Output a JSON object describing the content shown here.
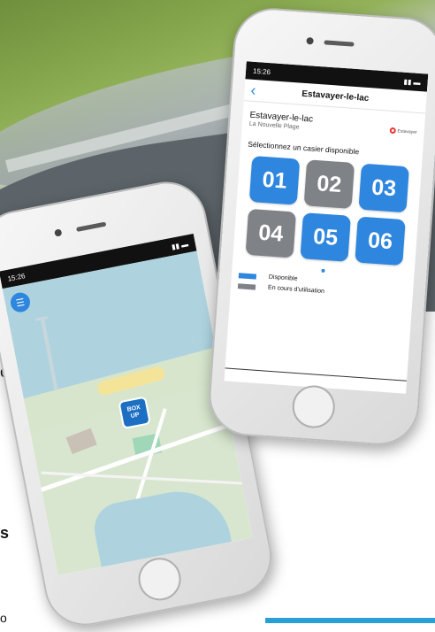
{
  "colors": {
    "available": "#2e86de",
    "in_use": "#7f8286",
    "pin": "#1d6fc4",
    "bluebar": "#2a9fd6"
  },
  "map_phone": {
    "status_time": "15:26",
    "menu_icon": "hamburger-menu-icon",
    "pin_label_top": "BOX",
    "pin_label_bottom": "UP"
  },
  "locker_phone": {
    "status_time": "15:26",
    "nav_title": "Estavayer-le-lac",
    "back_icon": "chevron-left-icon",
    "location_name": "Estavayer-le-lac",
    "location_sub": "La Nouvelle Plage",
    "brand_text": "Estavayer",
    "prompt": "Sélectionnez un casier disponible",
    "lockers": [
      {
        "label": "01",
        "status": "available"
      },
      {
        "label": "02",
        "status": "in_use"
      },
      {
        "label": "03",
        "status": "available"
      },
      {
        "label": "04",
        "status": "in_use"
      },
      {
        "label": "05",
        "status": "available"
      },
      {
        "label": "06",
        "status": "available"
      }
    ],
    "legend": [
      {
        "label": "Disponible",
        "status": "available"
      },
      {
        "label": "En cours d'utilisation",
        "status": "in_use"
      }
    ]
  },
  "fragments": {
    "f1": "o",
    "f2": "s",
    "f3": "o"
  }
}
